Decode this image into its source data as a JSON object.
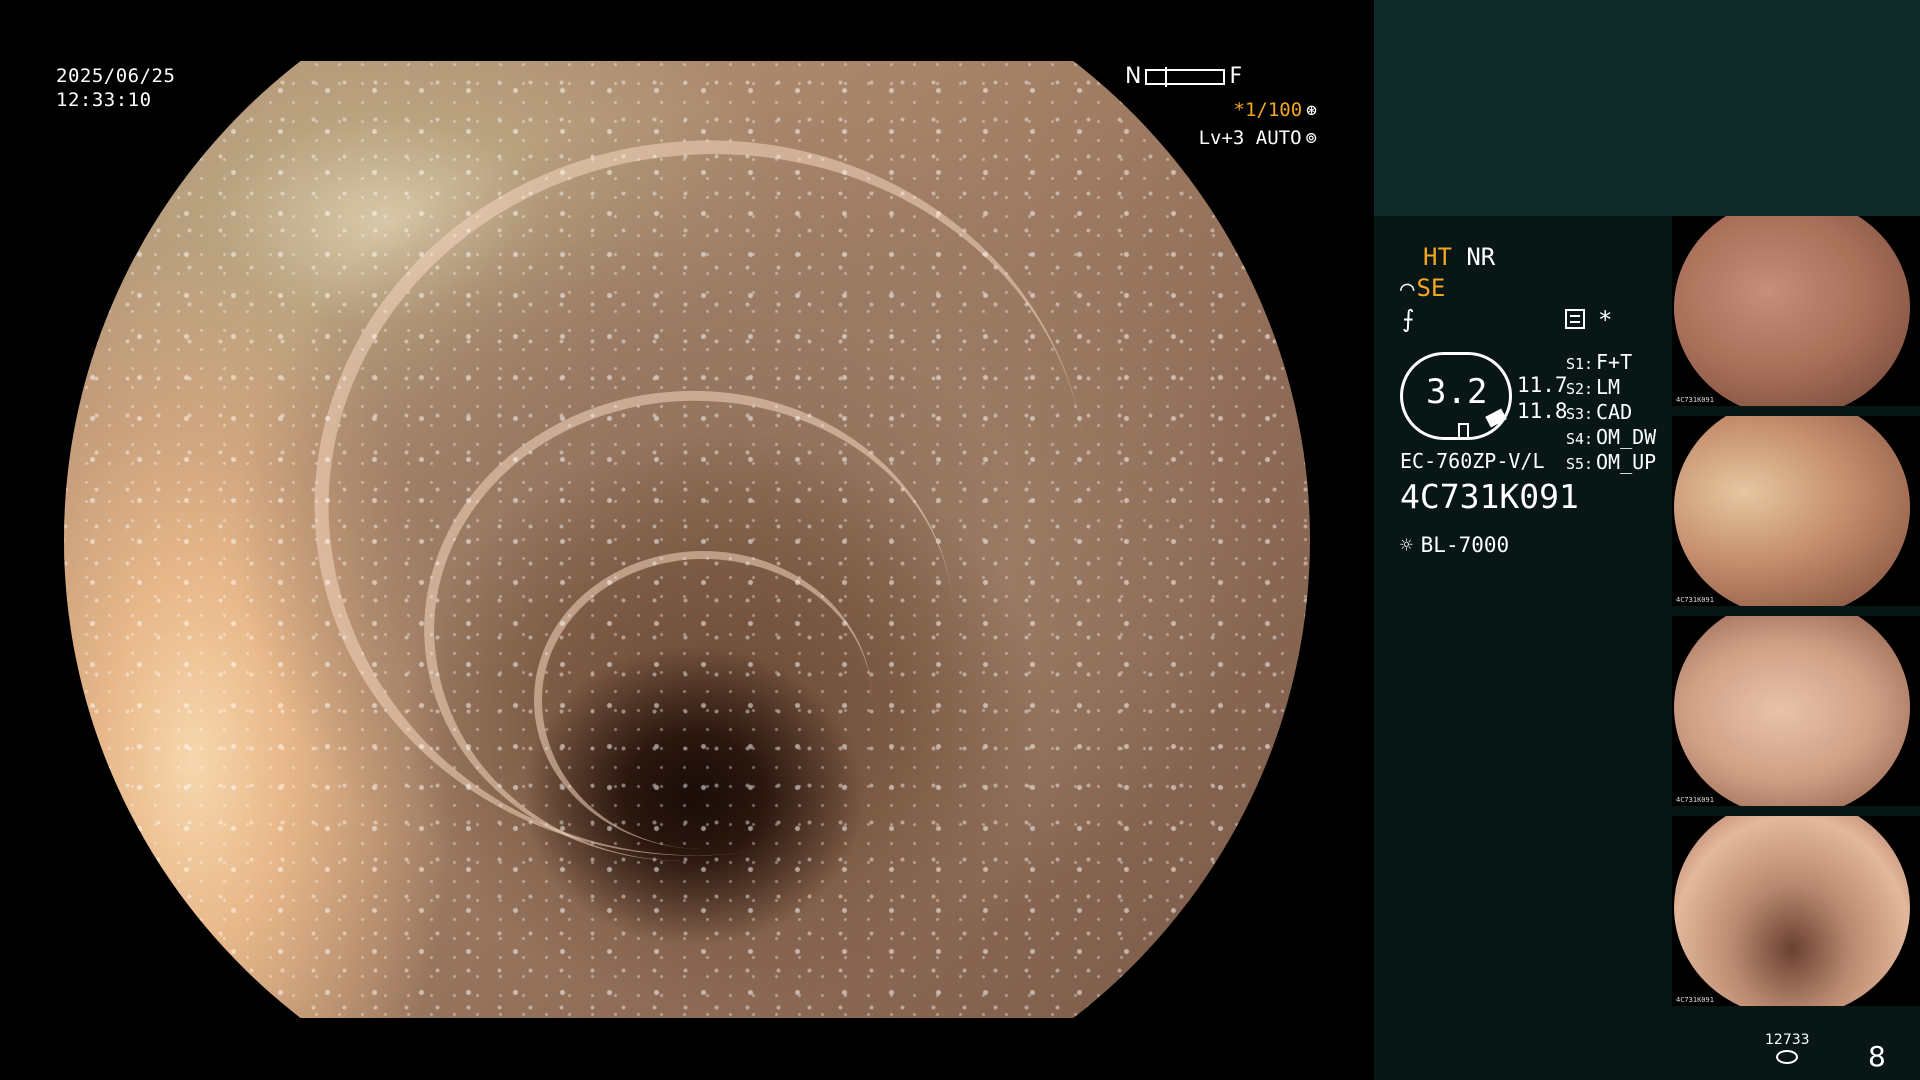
{
  "main_view": {
    "date": "2025/06/25",
    "time": "12:33:10",
    "nf_scale": {
      "near_label": "N",
      "far_label": "F"
    },
    "shutter": {
      "value": "*1/100",
      "icon": "aperture-icon"
    },
    "level": {
      "value": "Lv+3 AUTO",
      "icon": "auto-mode-icon"
    }
  },
  "panel": {
    "modes": {
      "ht": "HT",
      "nr": "NR",
      "se": "SE"
    },
    "star": "*",
    "scope_badge_value": "3.2",
    "values": [
      "11.7",
      "11.8"
    ],
    "model": "EC-760ZP-V/L",
    "serial": "4C731K091",
    "light_source": "BL-7000",
    "switches": [
      {
        "key": "S1:",
        "value": "F+T"
      },
      {
        "key": "S2:",
        "value": "LM"
      },
      {
        "key": "S3:",
        "value": "CAD"
      },
      {
        "key": "S4:",
        "value": "OM_DW"
      },
      {
        "key": "S5:",
        "value": "OM_UP"
      }
    ],
    "thumbnails": [
      {
        "id_text": "4C731K091"
      },
      {
        "id_text": "4C731K091"
      },
      {
        "id_text": "4C731K091"
      },
      {
        "id_text": "4C731K091"
      }
    ],
    "image_count": "12733",
    "page_number": "8"
  },
  "colors": {
    "accent_orange": "#f5a623",
    "panel_top_bg": "#0f2b29",
    "panel_bg": "#081615"
  }
}
